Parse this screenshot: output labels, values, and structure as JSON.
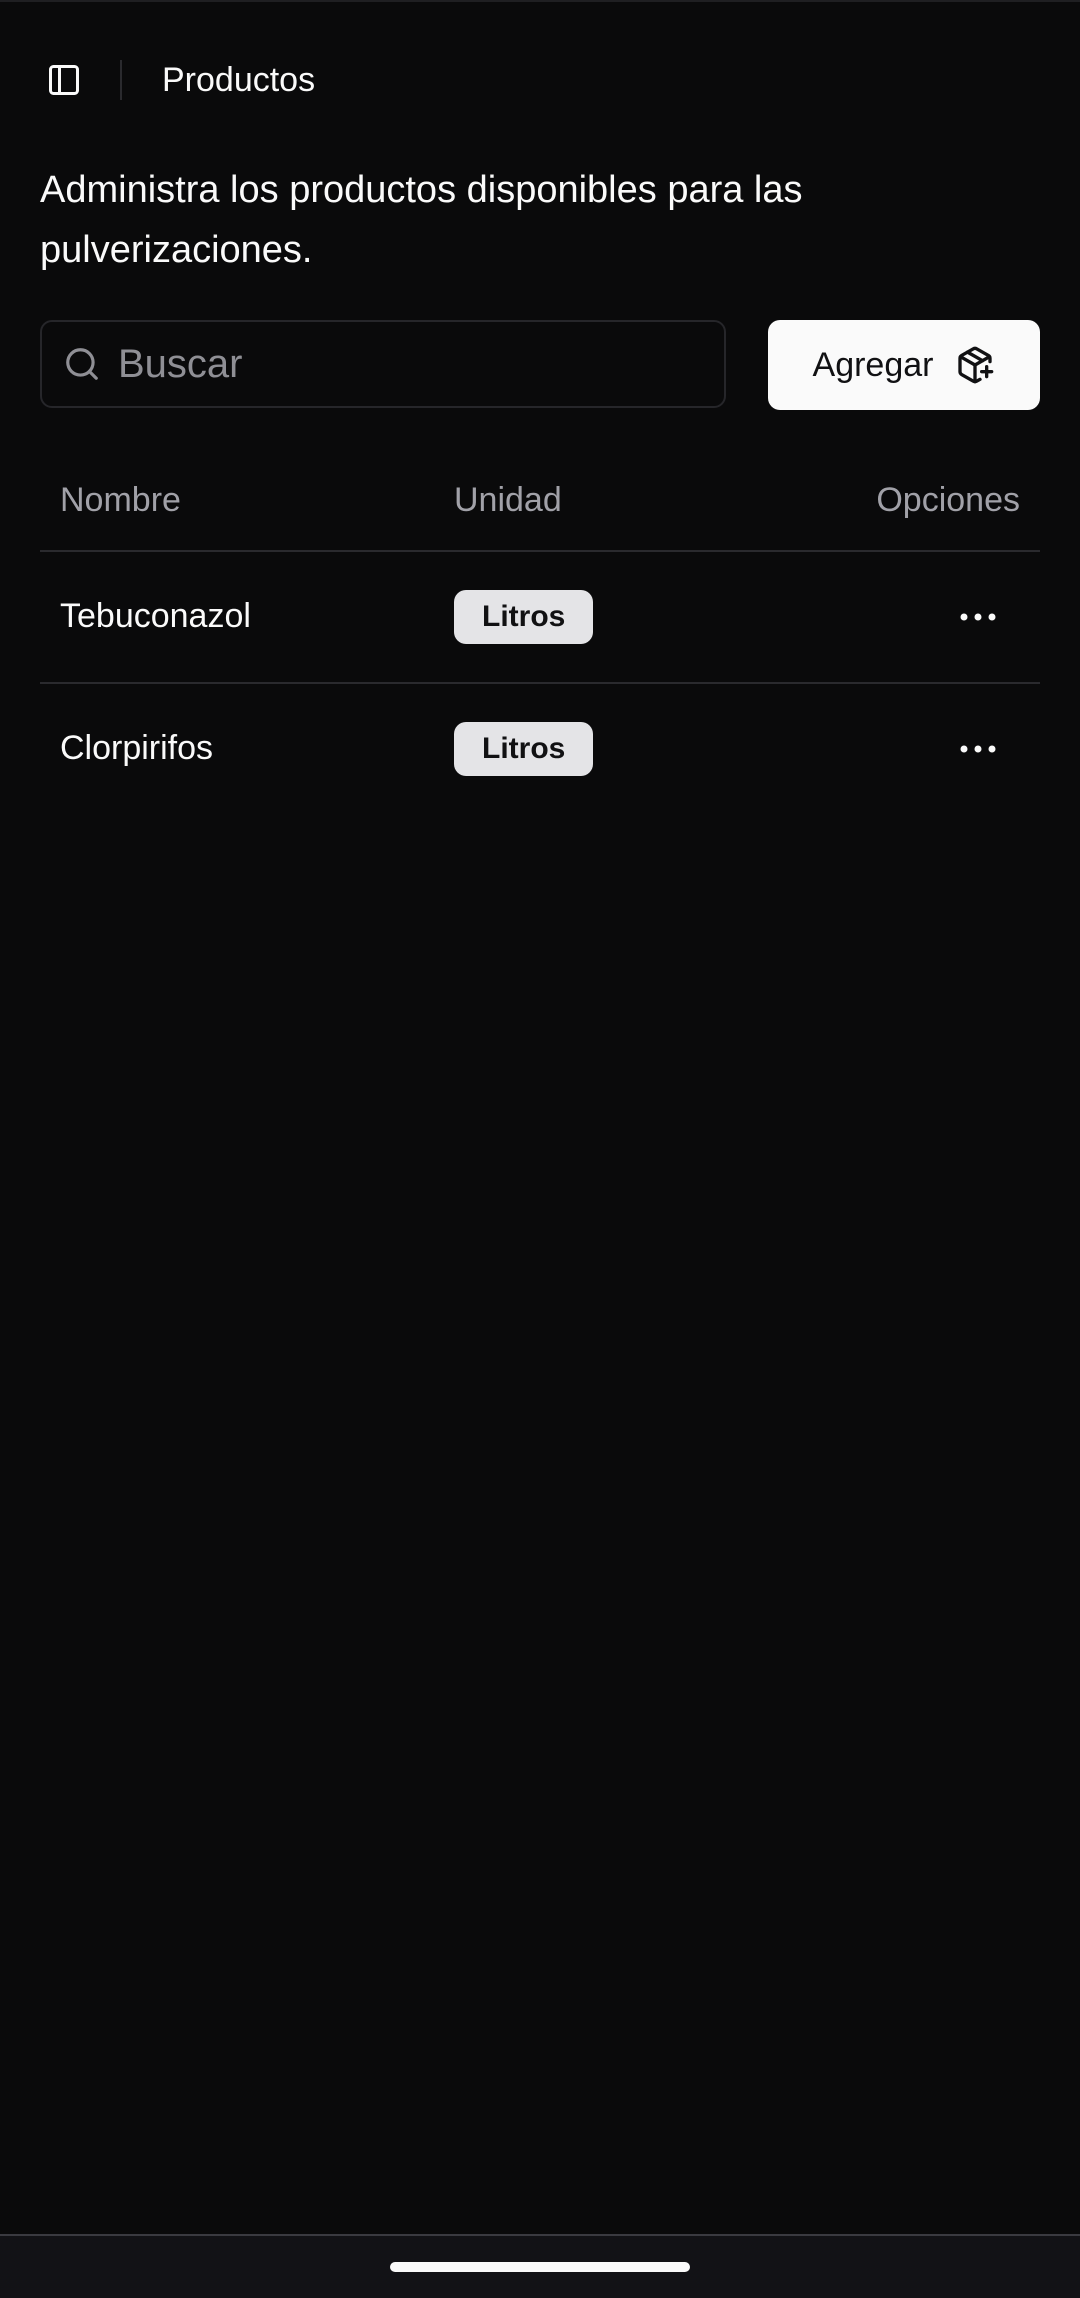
{
  "header": {
    "title": "Productos",
    "sidebar_toggle_icon": "sidebar-panel-icon"
  },
  "description": "Administra los productos disponibles para las pulverizaciones.",
  "search": {
    "placeholder": "Buscar",
    "value": "",
    "icon": "search-icon"
  },
  "add_button": {
    "label": "Agregar",
    "icon": "package-plus-icon"
  },
  "table": {
    "columns": [
      "Nombre",
      "Unidad",
      "Opciones"
    ],
    "rows": [
      {
        "nombre": "Tebuconazol",
        "unidad": "Litros",
        "options_icon": "more-horizontal-icon"
      },
      {
        "nombre": "Clorpirifos",
        "unidad": "Litros",
        "options_icon": "more-horizontal-icon"
      }
    ]
  },
  "colors": {
    "background": "#0a0a0b",
    "text": "#fafafa",
    "muted_text": "#a1a1a8",
    "border": "#2a2a2e",
    "badge_bg": "#e4e4e7",
    "button_bg": "#fafafa"
  }
}
